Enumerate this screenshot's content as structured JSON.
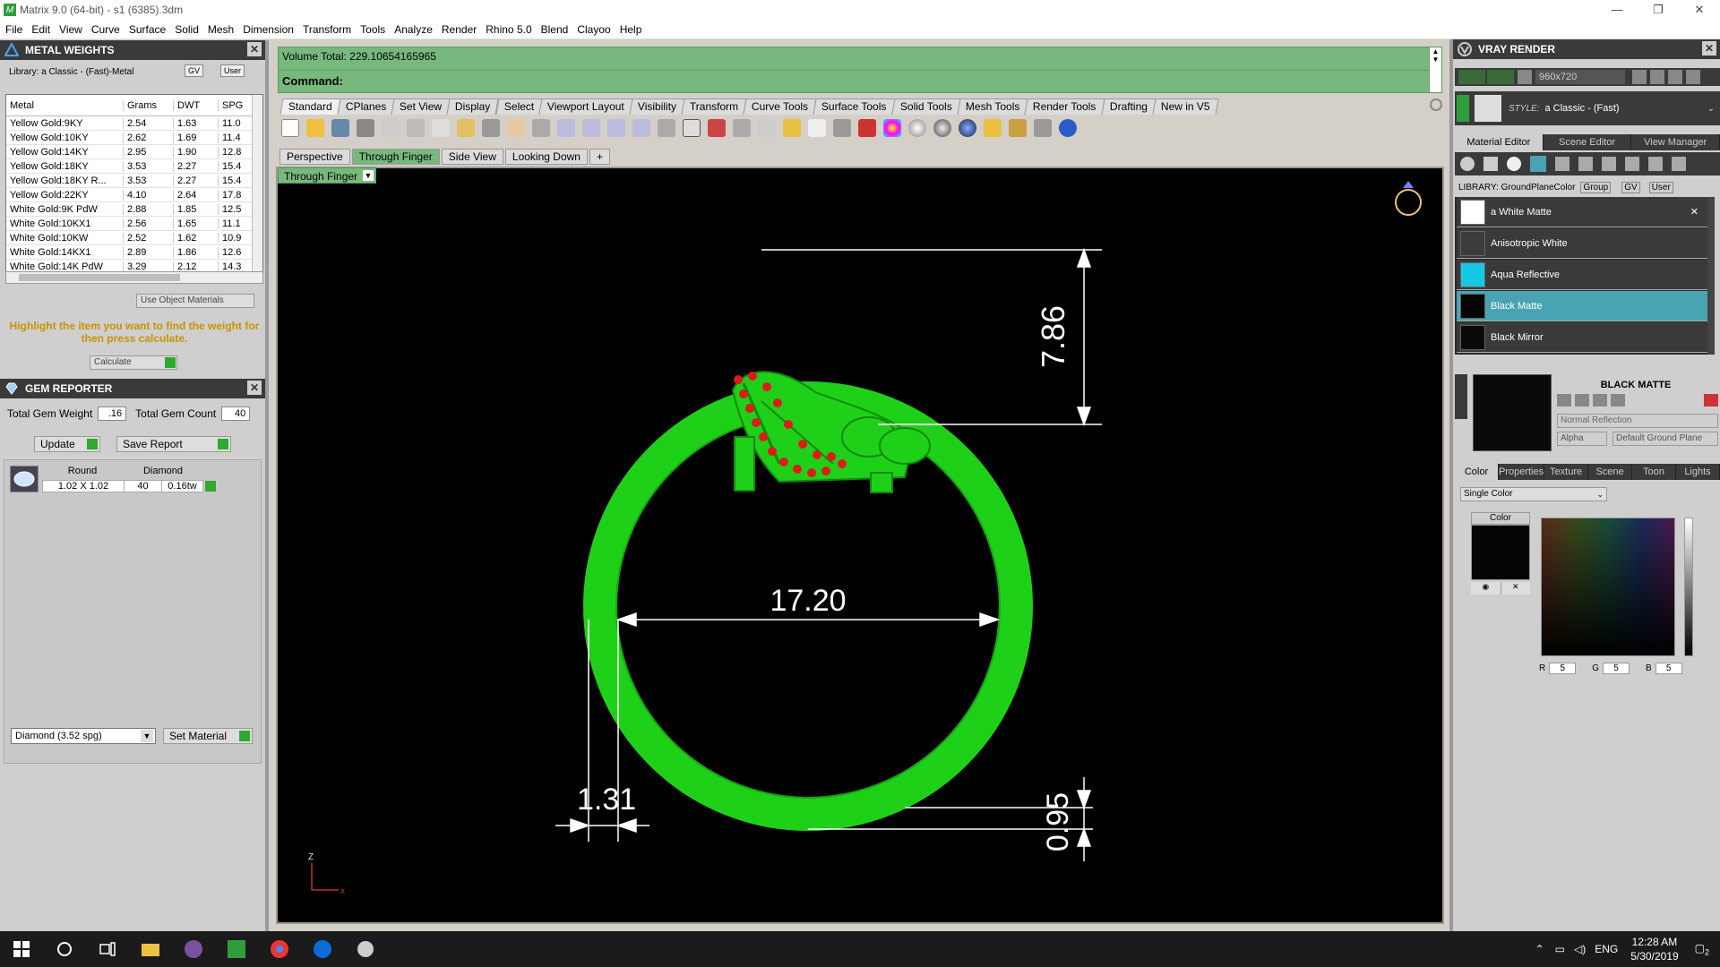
{
  "window": {
    "title": "Matrix 9.0 (64-bit) - s1 (6385).3dm",
    "minimize": "—",
    "restore": "❐",
    "close": "✕"
  },
  "menu": [
    "File",
    "Edit",
    "View",
    "Curve",
    "Surface",
    "Solid",
    "Mesh",
    "Dimension",
    "Transform",
    "Tools",
    "Analyze",
    "Render",
    "Rhino 5.0",
    "Blend",
    "Clayoo",
    "Help"
  ],
  "metal_weights": {
    "title": "METAL WEIGHTS",
    "library": "Library: a Classic - (Fast)-Metal",
    "gv": "GV",
    "user": "User",
    "columns": [
      "Metal",
      "Grams",
      "DWT",
      "SPG"
    ],
    "rows": [
      [
        "Yellow Gold:9KY",
        "2.54",
        "1.63",
        "11.0"
      ],
      [
        "Yellow Gold:10KY",
        "2.62",
        "1.69",
        "11.4"
      ],
      [
        "Yellow Gold:14KY",
        "2.95",
        "1.90",
        "12.8"
      ],
      [
        "Yellow Gold:18KY",
        "3.53",
        "2.27",
        "15.4"
      ],
      [
        "Yellow Gold:18KY R...",
        "3.53",
        "2.27",
        "15.4"
      ],
      [
        "Yellow Gold:22KY",
        "4.10",
        "2.64",
        "17.8"
      ],
      [
        "White Gold:9K PdW",
        "2.88",
        "1.85",
        "12.5"
      ],
      [
        "White Gold:10KX1",
        "2.56",
        "1.65",
        "11.1"
      ],
      [
        "White Gold:10KW",
        "2.52",
        "1.62",
        "10.9"
      ],
      [
        "White Gold:14KX1",
        "2.89",
        "1.86",
        "12.6"
      ],
      [
        "White Gold:14K PdW",
        "3.29",
        "2.12",
        "14.3"
      ]
    ],
    "use_object_materials": "Use Object Materials",
    "highlight_msg": "Highlight the item you want to find the weight for then press calculate.",
    "calculate": "Calculate"
  },
  "gem_reporter": {
    "title": "GEM REPORTER",
    "total_weight_label": "Total Gem Weight",
    "total_weight": ".16",
    "total_count_label": "Total Gem Count",
    "total_count": "40",
    "update": "Update",
    "save_report": "Save Report",
    "columns": [
      "Round",
      "Diamond"
    ],
    "row": {
      "size": "1.02 X 1.02",
      "count": "40",
      "weight": "0.16tw"
    },
    "material_select": "Diamond    (3.52 spg)",
    "set_material": "Set Material"
  },
  "command": {
    "volume": "Volume Total: 229.10654165965",
    "label": "Command:"
  },
  "toolbar_tabs": [
    "Standard",
    "CPlanes",
    "Set View",
    "Display",
    "Select",
    "Viewport Layout",
    "Visibility",
    "Transform",
    "Curve Tools",
    "Surface Tools",
    "Solid Tools",
    "Mesh Tools",
    "Render Tools",
    "Drafting",
    "New in V5"
  ],
  "view_tabs": [
    "Perspective",
    "Through Finger",
    "Side View",
    "Looking Down",
    "+"
  ],
  "viewport_name": "Through Finger",
  "dimensions": {
    "height": "7.86",
    "diameter": "17.20",
    "band_width": "1.31",
    "band_thickness": "0.95"
  },
  "axis": {
    "z": "Z",
    "x": "x"
  },
  "vray": {
    "title": "VRAY RENDER",
    "resolution": "960x720",
    "style_label": "STYLE:",
    "style_value": "a Classic - (Fast)",
    "editor_tabs": [
      "Material Editor",
      "Scene Editor",
      "View Manager"
    ],
    "library": "LIBRARY: GroundPlaneColor",
    "group": "Group",
    "gv": "GV",
    "user": "User",
    "materials": [
      {
        "name": "a White Matte",
        "color": "#ffffff"
      },
      {
        "name": "Anisotropic White",
        "color": "#3c3c3c"
      },
      {
        "name": "Aqua Reflective",
        "color": "#14c8e6"
      },
      {
        "name": "Black Matte",
        "color": "#050505"
      },
      {
        "name": "Black Mirror",
        "color": "#0a0a0a"
      }
    ],
    "selected_material": "BLACK MATTE",
    "reflection": "Normal Reflection",
    "alpha": "Alpha",
    "ground": "Default Ground Plane",
    "prop_tabs": [
      "Color",
      "Properties",
      "Texture",
      "Scene",
      "Toon",
      "Lights"
    ],
    "color_mode": "Single Color",
    "color_label": "Color",
    "rgb": {
      "r_label": "R",
      "r": "5",
      "g_label": "G",
      "g": "5",
      "b_label": "B",
      "b": "5"
    }
  },
  "taskbar": {
    "time": "12:28 AM",
    "date": "5/30/2019",
    "lang": "ENG",
    "notif": "2"
  },
  "colors": {
    "ring": "#22e01e",
    "accent": "#77b97d",
    "selected": "#4aa3b3"
  }
}
